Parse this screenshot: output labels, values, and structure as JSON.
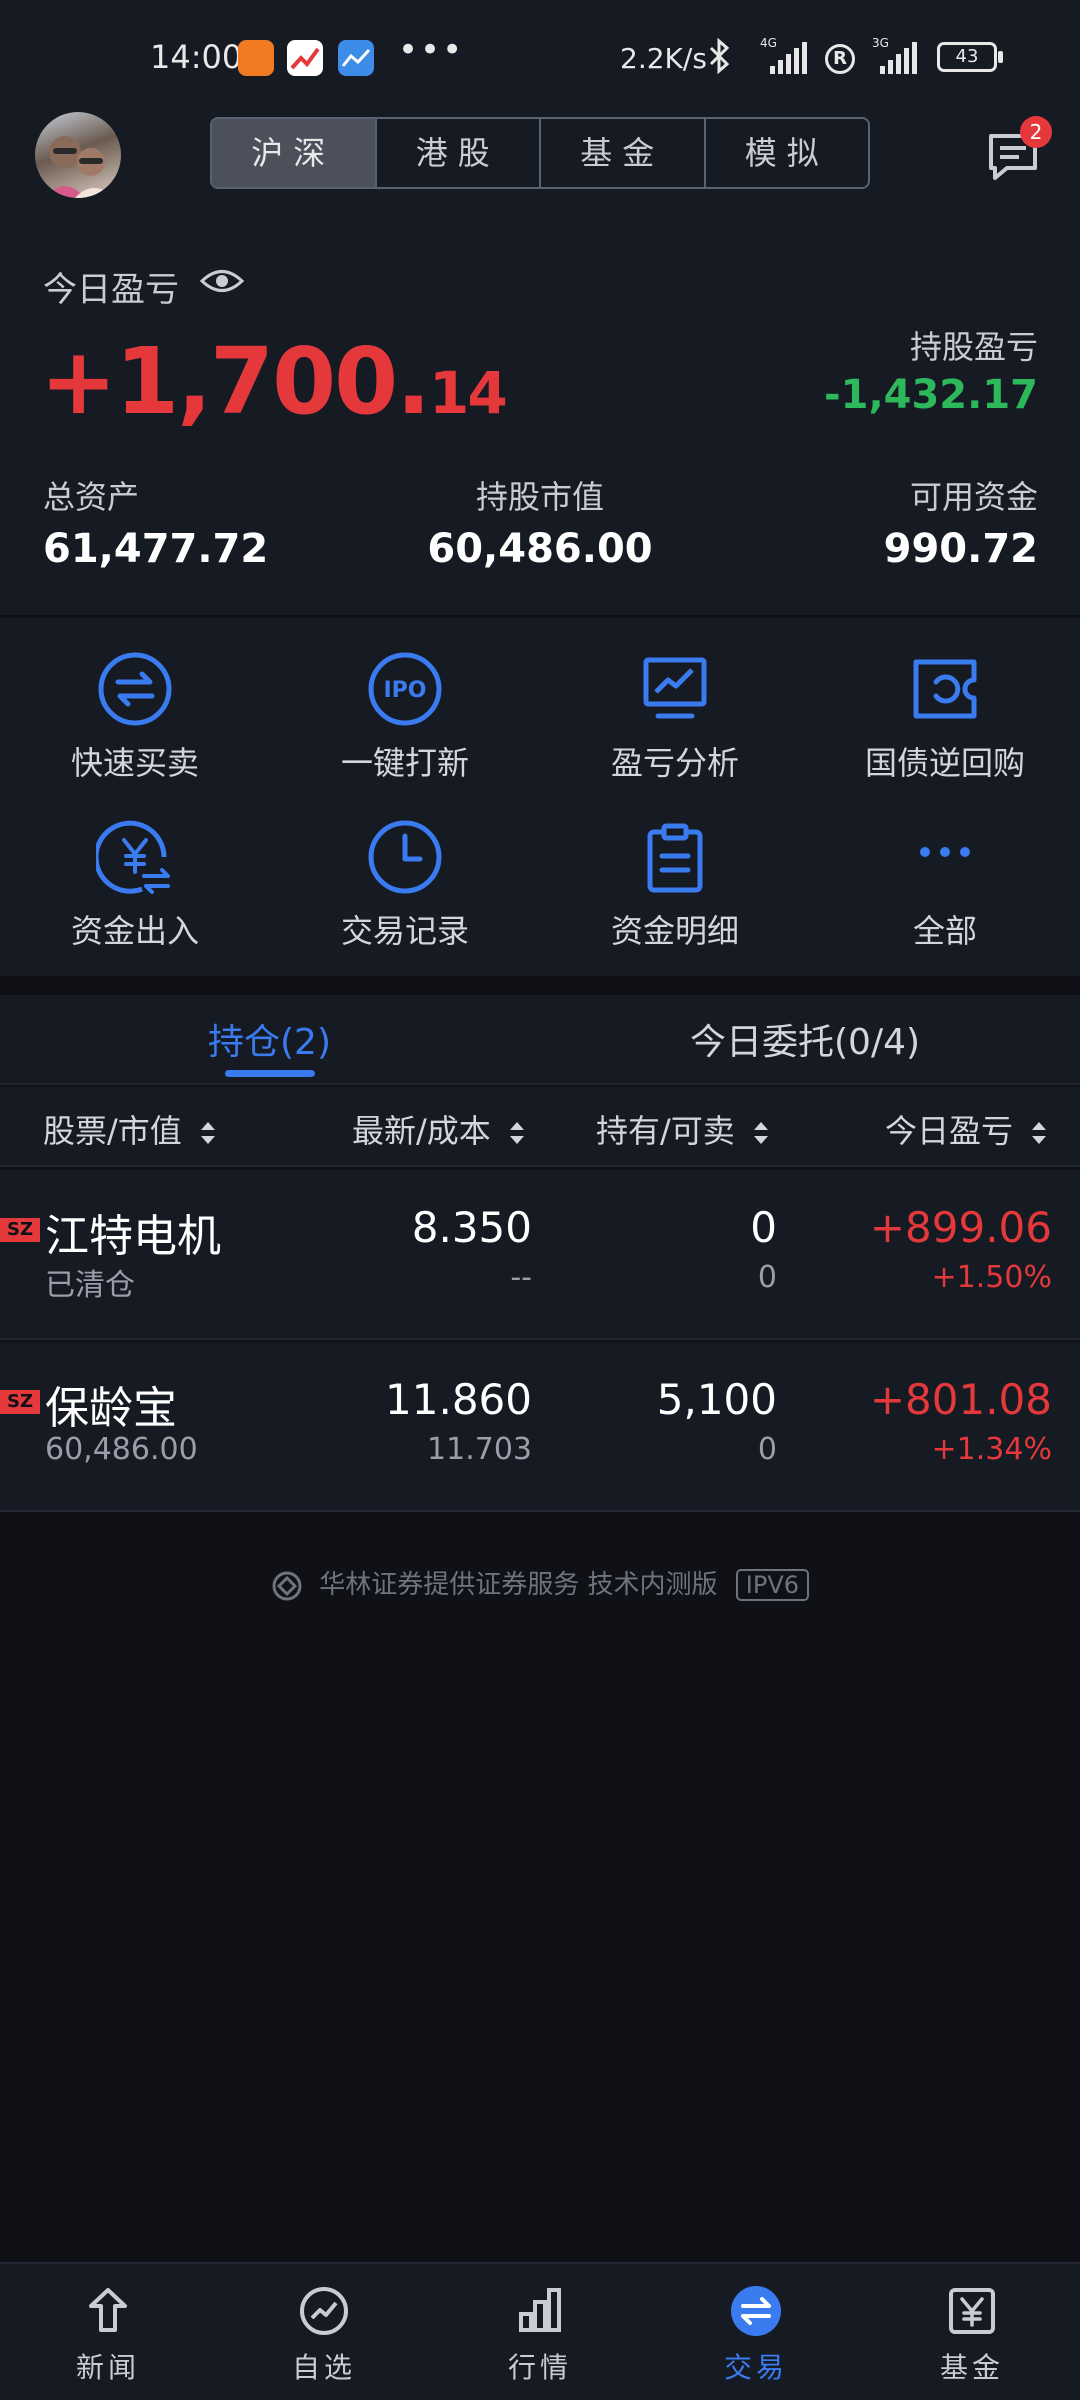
{
  "status_bar": {
    "time": "14:00",
    "dots": "•••",
    "speed": "2.2K/s",
    "network_a": "4G",
    "network_b": "3G",
    "battery": "43"
  },
  "header": {
    "market_tabs": [
      {
        "label": "沪深",
        "active": true
      },
      {
        "label": "港股",
        "active": false
      },
      {
        "label": "基金",
        "active": false
      },
      {
        "label": "模拟",
        "active": false
      }
    ],
    "message_badge": "2"
  },
  "summary": {
    "today_pl_label": "今日盈亏",
    "today_pl_int": "+1,700.",
    "today_pl_dec": "14",
    "holding_pl_label": "持股盈亏",
    "holding_pl_value": "-1,432.17",
    "total_assets_label": "总资产",
    "total_assets_value": "61,477.72",
    "market_value_label": "持股市值",
    "market_value_value": "60,486.00",
    "available_label": "可用资金",
    "available_value": "990.72"
  },
  "actions": [
    {
      "label": "快速买卖",
      "icon": "swap-icon"
    },
    {
      "label": "一键打新",
      "icon": "ipo-icon"
    },
    {
      "label": "盈亏分析",
      "icon": "chart-analysis-icon"
    },
    {
      "label": "国债逆回购",
      "icon": "reverse-repo-icon"
    },
    {
      "label": "资金出入",
      "icon": "yuan-transfer-icon"
    },
    {
      "label": "交易记录",
      "icon": "clock-icon"
    },
    {
      "label": "资金明细",
      "icon": "clipboard-icon"
    },
    {
      "label": "全部",
      "icon": "more-icon"
    }
  ],
  "tabs": {
    "positions": "持仓(2)",
    "orders": "今日委托(0/4)"
  },
  "columns": {
    "stock": "股票/市值",
    "price": "最新/成本",
    "qty": "持有/可卖",
    "pl": "今日盈亏"
  },
  "holdings": [
    {
      "exchange": "SZ",
      "name": "江特电机",
      "sub": "已清仓",
      "latest": "8.350",
      "cost": "--",
      "hold": "0",
      "sellable": "0",
      "pl": "+899.06",
      "pl_pct": "+1.50%"
    },
    {
      "exchange": "SZ",
      "name": "保龄宝",
      "sub": "60,486.00",
      "latest": "11.860",
      "cost": "11.703",
      "hold": "5,100",
      "sellable": "0",
      "pl": "+801.08",
      "pl_pct": "+1.34%"
    }
  ],
  "footer_note": "华林证券提供证券服务 技术内测版",
  "footer_badge": "IPV6",
  "bottom_nav": [
    {
      "label": "新闻",
      "icon": "news-icon",
      "active": false
    },
    {
      "label": "自选",
      "icon": "watchlist-icon",
      "active": false
    },
    {
      "label": "行情",
      "icon": "market-icon",
      "active": false
    },
    {
      "label": "交易",
      "icon": "trade-icon",
      "active": true
    },
    {
      "label": "基金",
      "icon": "fund-icon",
      "active": false
    }
  ],
  "colors": {
    "up": "#e5383b",
    "down": "#2eb85c",
    "accent": "#3a7bf0",
    "background": "#0f1117",
    "panel": "#161a23"
  }
}
